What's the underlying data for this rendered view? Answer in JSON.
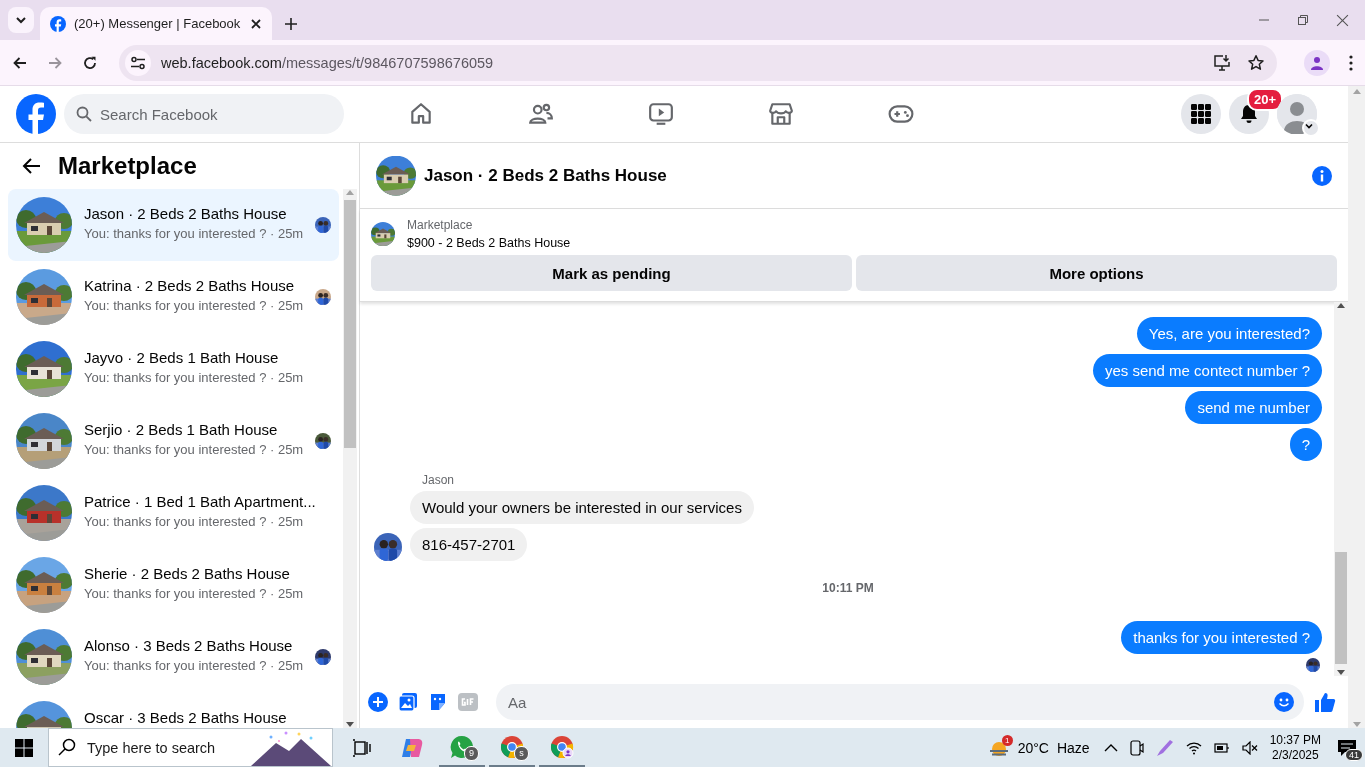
{
  "browser": {
    "tab_title": "(20+) Messenger | Facebook",
    "url_host": "web.facebook.com",
    "url_path": "/messages/t/9846707598676059"
  },
  "header": {
    "search_placeholder": "Search Facebook",
    "nav": [
      {
        "kind": "home"
      },
      {
        "kind": "friends"
      },
      {
        "kind": "video"
      },
      {
        "kind": "marketplace"
      },
      {
        "kind": "gaming"
      }
    ],
    "notification_badge": "20+"
  },
  "sidebar": {
    "title": "Marketplace",
    "conversations": [
      {
        "name": "Jason · 2 Beds 2 Baths House",
        "preview": "You: thanks for you interested ? · 25m",
        "selected": true,
        "seen": true
      },
      {
        "name": "Katrina · 2 Beds 2 Baths House",
        "preview": "You: thanks for you interested ? · 25m",
        "selected": false,
        "seen": true
      },
      {
        "name": "Jayvo · 2 Beds 1 Bath House",
        "preview": "You: thanks for you interested ? · 25m",
        "selected": false,
        "seen": false
      },
      {
        "name": "Serjio · 2 Beds 1 Bath House",
        "preview": "You: thanks for you interested ? · 25m",
        "selected": false,
        "seen": true
      },
      {
        "name": "Patrice · 1 Bed 1 Bath Apartment...",
        "preview": "You: thanks for you interested ? · 25m",
        "selected": false,
        "seen": false
      },
      {
        "name": "Sherie · 2 Beds 2 Baths House",
        "preview": "You: thanks for you interested ? · 25m",
        "selected": false,
        "seen": false
      },
      {
        "name": "Alonso · 3 Beds 2 Baths House",
        "preview": "You: thanks for you interested ? · 25m",
        "selected": false,
        "seen": true
      },
      {
        "name": "Oscar · 3 Beds 2 Baths House",
        "selected": false,
        "seen": false
      }
    ]
  },
  "chat": {
    "title": "Jason · 2 Beds 2 Baths House",
    "listing_label": "Marketplace",
    "listing": "$900 - 2 Beds 2 Baths House",
    "buttons": [
      "Mark as pending",
      "More options"
    ],
    "messages": [
      {
        "kind": "sent",
        "text": "Yes, are you interested?"
      },
      {
        "kind": "sent",
        "text": "yes send me contect number ?"
      },
      {
        "kind": "sent",
        "text": "send me number"
      },
      {
        "kind": "sent",
        "text": "?"
      },
      {
        "kind": "sender",
        "text": "Jason"
      },
      {
        "kind": "received",
        "text": "Would your owners be interested in our services",
        "avatar": false
      },
      {
        "kind": "received",
        "text": "816-457-2701",
        "avatar": true
      },
      {
        "kind": "time",
        "text": "10:11 PM"
      },
      {
        "kind": "sent",
        "text": "thanks for you interested ?"
      },
      {
        "kind": "seen"
      }
    ],
    "composer_placeholder": "Aa"
  },
  "taskbar": {
    "search_placeholder": "Type here to search",
    "whatsapp_badge": "9",
    "chrome_profile_badge": "s",
    "weather_badge": "1",
    "temperature": "20°C",
    "weather": "Haze",
    "time": "10:37 PM",
    "date": "2/3/2025",
    "notifications": "41"
  }
}
